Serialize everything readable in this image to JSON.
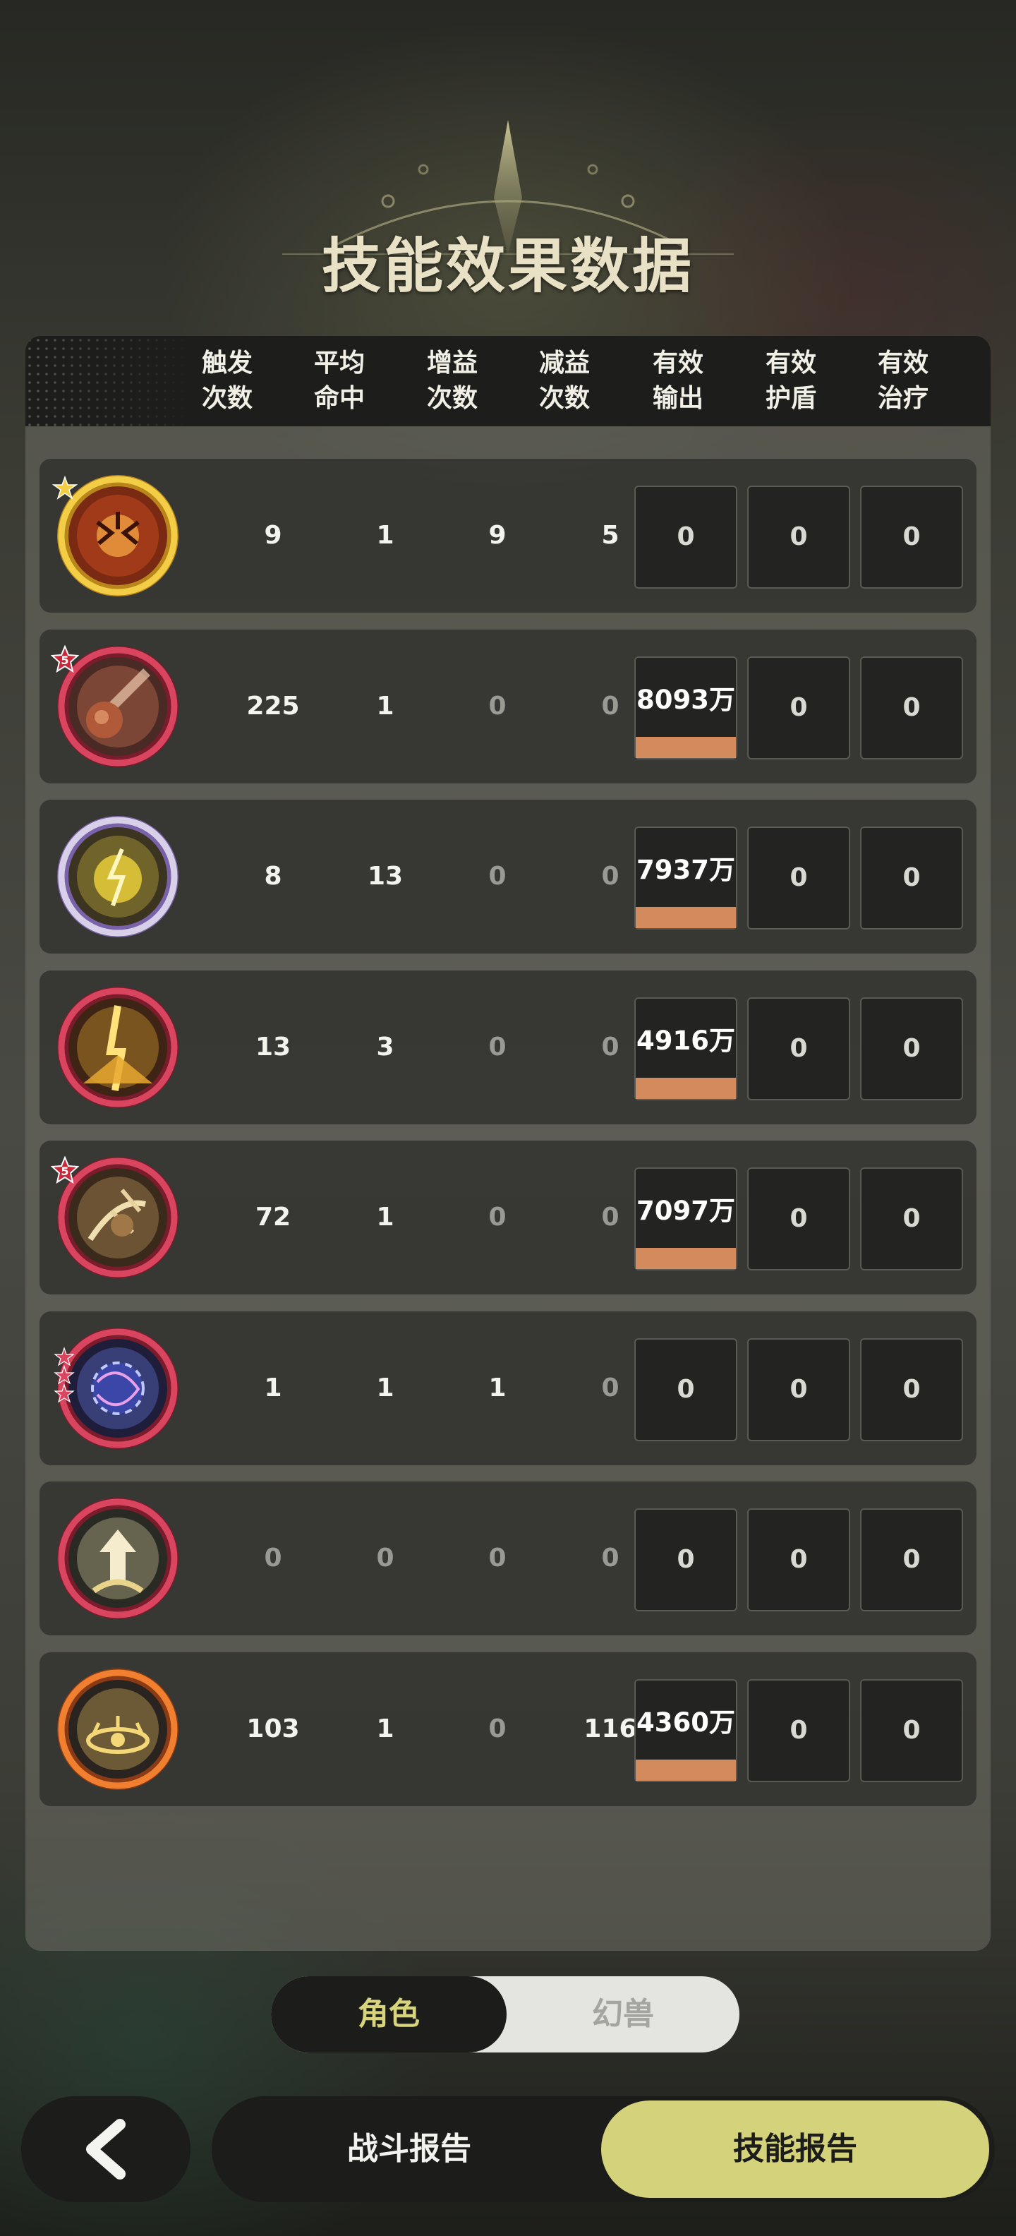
{
  "title": "技能效果数据",
  "headers": [
    {
      "line1": "触发",
      "line2": "次数"
    },
    {
      "line1": "平均",
      "line2": "命中"
    },
    {
      "line1": "增益",
      "line2": "次数"
    },
    {
      "line1": "减益",
      "line2": "次数"
    },
    {
      "line1": "有效",
      "line2": "输出"
    },
    {
      "line1": "有效",
      "line2": "护盾"
    },
    {
      "line1": "有效",
      "line2": "治疗"
    }
  ],
  "rows": [
    {
      "icon": "explosion-skill-icon",
      "badge": "star",
      "trigger": "9",
      "hits": "1",
      "buff": "9",
      "debuff": "5",
      "output": "0",
      "shield": "0",
      "heal": "0",
      "has_bar": false
    },
    {
      "icon": "meteor-skill-icon",
      "badge": "5",
      "trigger": "225",
      "hits": "1",
      "buff": "0",
      "debuff": "0",
      "output": "8093万",
      "shield": "0",
      "heal": "0",
      "has_bar": true
    },
    {
      "icon": "lightning-orb-skill-icon",
      "badge": "",
      "trigger": "8",
      "hits": "13",
      "buff": "0",
      "debuff": "0",
      "output": "7937万",
      "shield": "0",
      "heal": "0",
      "has_bar": true
    },
    {
      "icon": "thunder-strike-skill-icon",
      "badge": "",
      "trigger": "13",
      "hits": "3",
      "buff": "0",
      "debuff": "0",
      "output": "4916万",
      "shield": "0",
      "heal": "0",
      "has_bar": true
    },
    {
      "icon": "slash-skill-icon",
      "badge": "5",
      "trigger": "72",
      "hits": "1",
      "buff": "0",
      "debuff": "0",
      "output": "7097万",
      "shield": "0",
      "heal": "0",
      "has_bar": true
    },
    {
      "icon": "vortex-skill-icon",
      "badge": "stars",
      "trigger": "1",
      "hits": "1",
      "buff": "1",
      "debuff": "0",
      "output": "0",
      "shield": "0",
      "heal": "0",
      "has_bar": false
    },
    {
      "icon": "power-up-skill-icon",
      "badge": "",
      "trigger": "0",
      "hits": "0",
      "buff": "0",
      "debuff": "0",
      "output": "0",
      "shield": "0",
      "heal": "0",
      "has_bar": false
    },
    {
      "icon": "ring-trap-skill-icon",
      "badge": "",
      "trigger": "103",
      "hits": "1",
      "buff": "0",
      "debuff": "116",
      "output": "4360万",
      "shield": "0",
      "heal": "0",
      "has_bar": true
    }
  ],
  "toggle": {
    "active": "角色",
    "inactive": "幻兽"
  },
  "nav": {
    "back_icon": "chevron-left-icon",
    "battle_report": "战斗报告",
    "skill_report": "技能报告"
  },
  "colors": {
    "accent": "#d4d37c",
    "bar": "#d38a5c"
  }
}
